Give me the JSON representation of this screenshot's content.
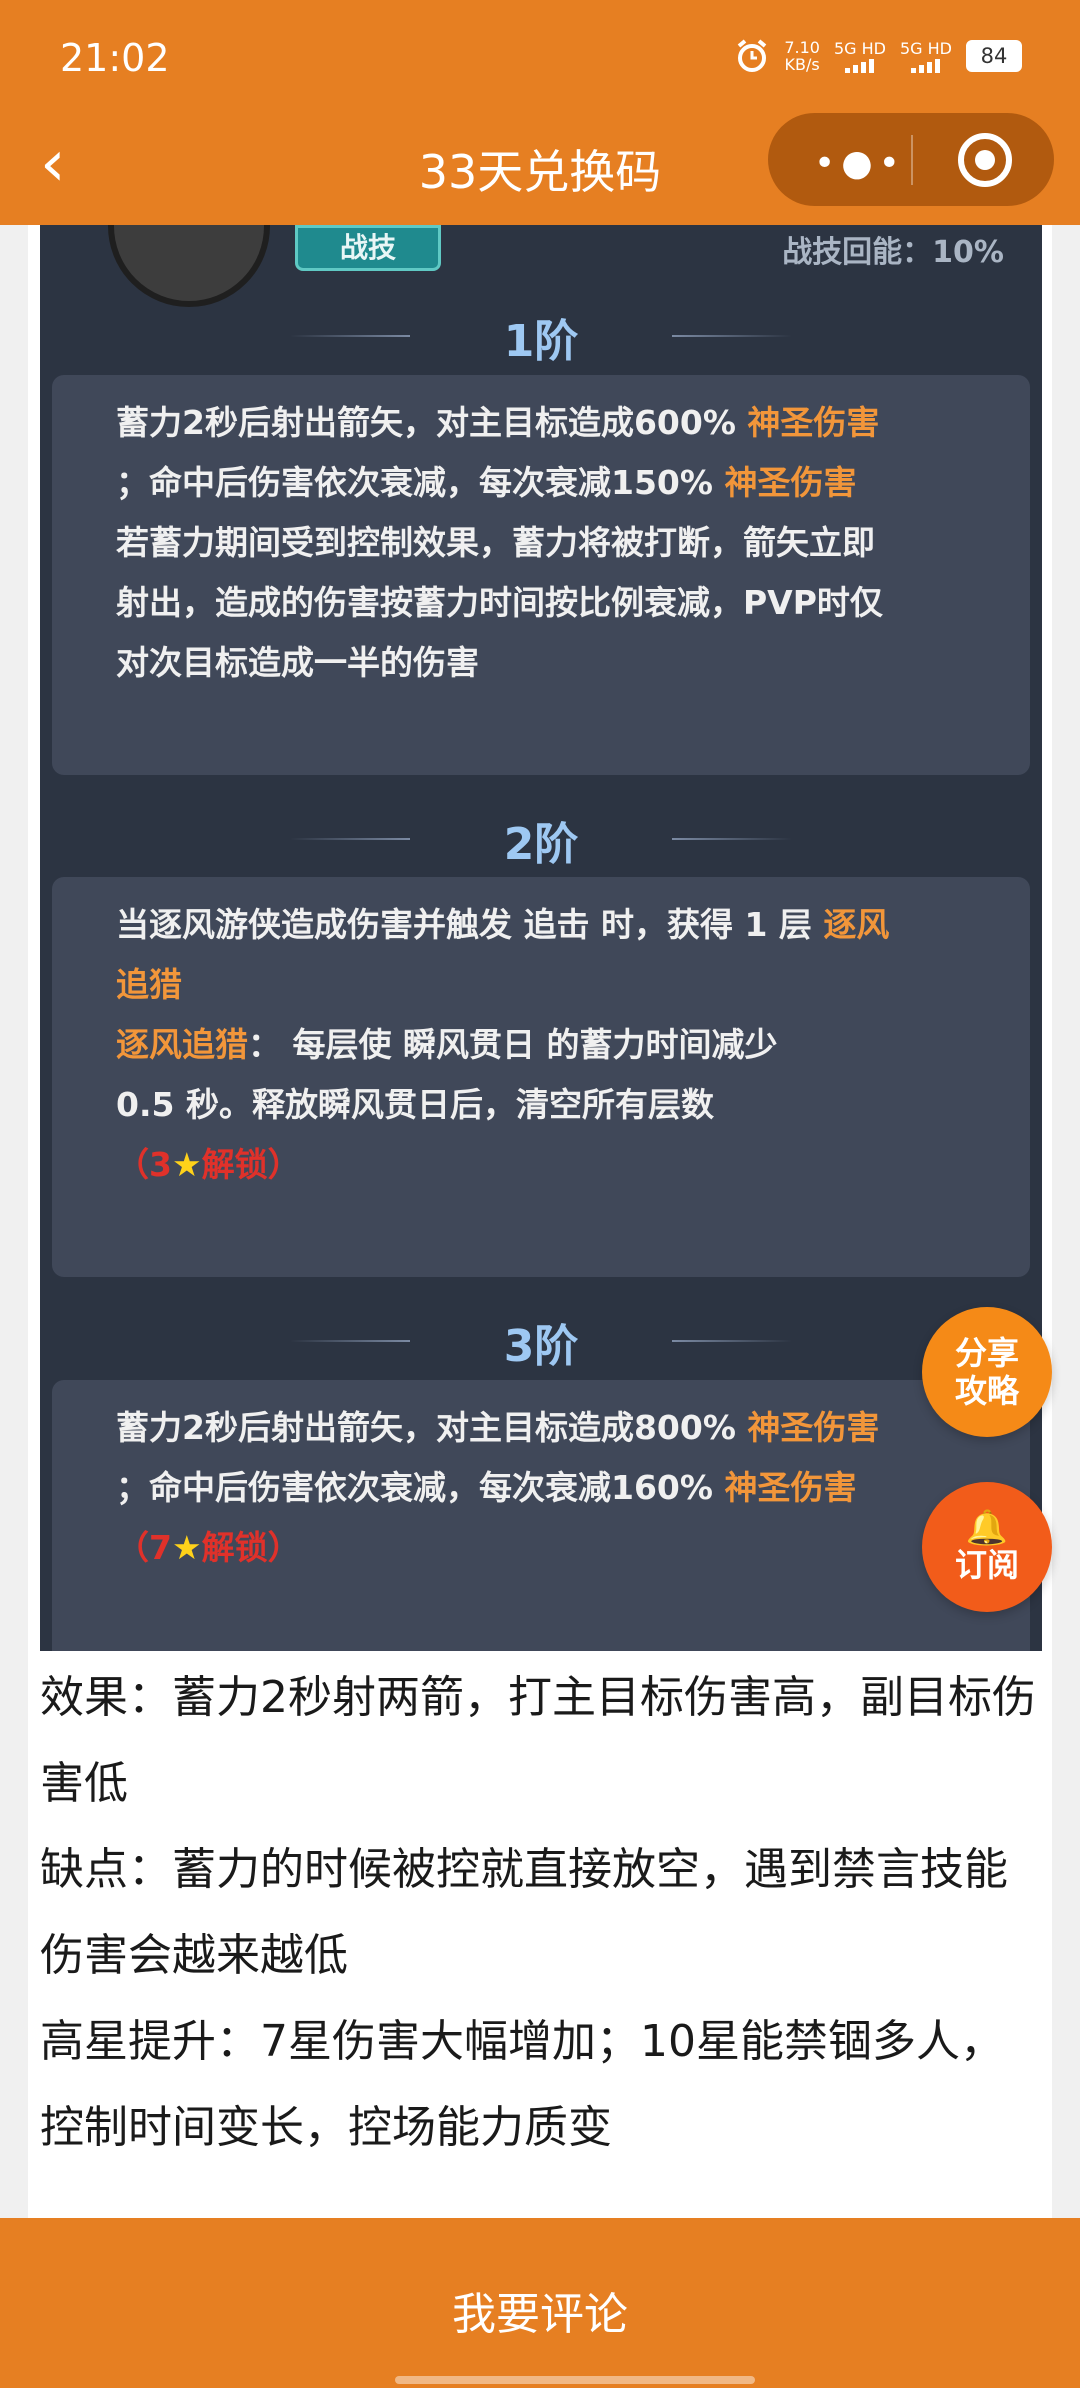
{
  "status_bar": {
    "time": "21:02",
    "net_speed": "7.10",
    "net_unit": "KB/s",
    "sim1": "5G HD",
    "sim2": "5G HD",
    "battery": "84"
  },
  "header": {
    "title": "33天兑换码",
    "more_icon": "more-dots-icon",
    "close_icon": "target-icon"
  },
  "screenshot": {
    "skill_type": "战技",
    "energy": "战技回能：10%",
    "tiers": [
      {
        "label": "1阶",
        "lines": [
          [
            "蓄力2秒后射出箭矢，对主目标造成600% ",
            "神圣伤害"
          ],
          [
            "；命中后伤害依次衰减，每次衰减150% ",
            "神圣伤害"
          ],
          [
            "若蓄力期间受到控制效果，蓄力将被打断，箭矢立即"
          ],
          [
            "射出，造成的伤害按蓄力时间按比例衰减，PVP时仅"
          ],
          [
            "对次目标造成一半的伤害"
          ]
        ]
      },
      {
        "label": "2阶",
        "line1": "当逐风游侠造成伤害并触发 追击 时，获得 1 层 ",
        "line1_hl": "逐风",
        "line2_hl": "追猎",
        "line3_hl": "逐风追猎",
        "line3": "：  每层使 瞬风贯日 的蓄力时间减少",
        "line4": "0.5 秒。释放瞬风贯日后，清空所有层数",
        "unlock_open": "（3",
        "unlock_star": "★",
        "unlock_text": "解锁）"
      },
      {
        "label": "3阶",
        "lines": [
          [
            "蓄力2秒后射出箭矢，对主目标造成800% ",
            "神圣伤害"
          ],
          [
            "；命中后伤害依次衰减，每次衰减160% ",
            "神圣伤害"
          ]
        ],
        "unlock_open": "（7",
        "unlock_star": "★",
        "unlock_text": "解锁）"
      }
    ]
  },
  "article": {
    "p1": "效果：蓄力2秒射两箭，打主目标伤害高，副目标伤害低",
    "p2": "缺点：蓄力的时候被控就直接放空，遇到禁言技能伤害会越来越低",
    "p3": "高星提升：7星伤害大幅增加；10星能禁锢多人，控制时间变长，控场能力质变"
  },
  "fabs": {
    "share": "分享\n攻略",
    "subscribe_icon": "bell-icon",
    "subscribe": "订阅"
  },
  "footer": {
    "comment": "我要评论"
  },
  "colors": {
    "brand": "#e67f22",
    "highlight": "#f2963a",
    "unlock": "#e0312a"
  }
}
